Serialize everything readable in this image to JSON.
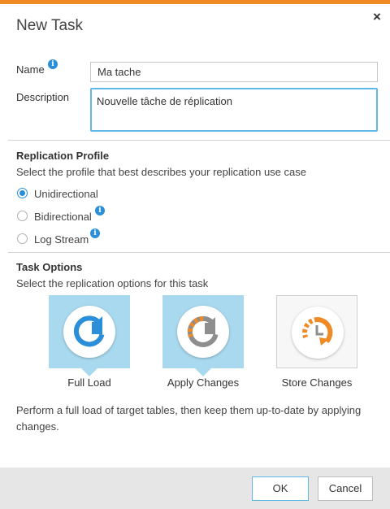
{
  "dialog": {
    "title": "New Task",
    "close_symbol": "×",
    "accent_color": "#f08a24"
  },
  "form": {
    "name_label": "Name",
    "name_value": "Ma tache",
    "description_label": "Description",
    "description_value": "Nouvelle tâche de réplication"
  },
  "replication_profile": {
    "title": "Replication Profile",
    "subtitle": "Select the profile that best describes your replication use case",
    "options": [
      {
        "label": "Unidirectional",
        "checked": true,
        "info": false
      },
      {
        "label": "Bidirectional",
        "checked": false,
        "info": true
      },
      {
        "label": "Log Stream",
        "checked": false,
        "info": true
      }
    ]
  },
  "task_options": {
    "title": "Task Options",
    "subtitle": "Select the replication options for this task",
    "tiles": [
      {
        "label": "Full Load",
        "icon": "full-load-icon",
        "selected": true
      },
      {
        "label": "Apply Changes",
        "icon": "apply-changes-icon",
        "selected": true
      },
      {
        "label": "Store Changes",
        "icon": "store-changes-icon",
        "selected": false
      }
    ],
    "description": "Perform a full load of target tables, then keep them up-to-date by applying changes."
  },
  "footer": {
    "ok_label": "OK",
    "cancel_label": "Cancel"
  },
  "icons": {
    "info_glyph": "i"
  }
}
